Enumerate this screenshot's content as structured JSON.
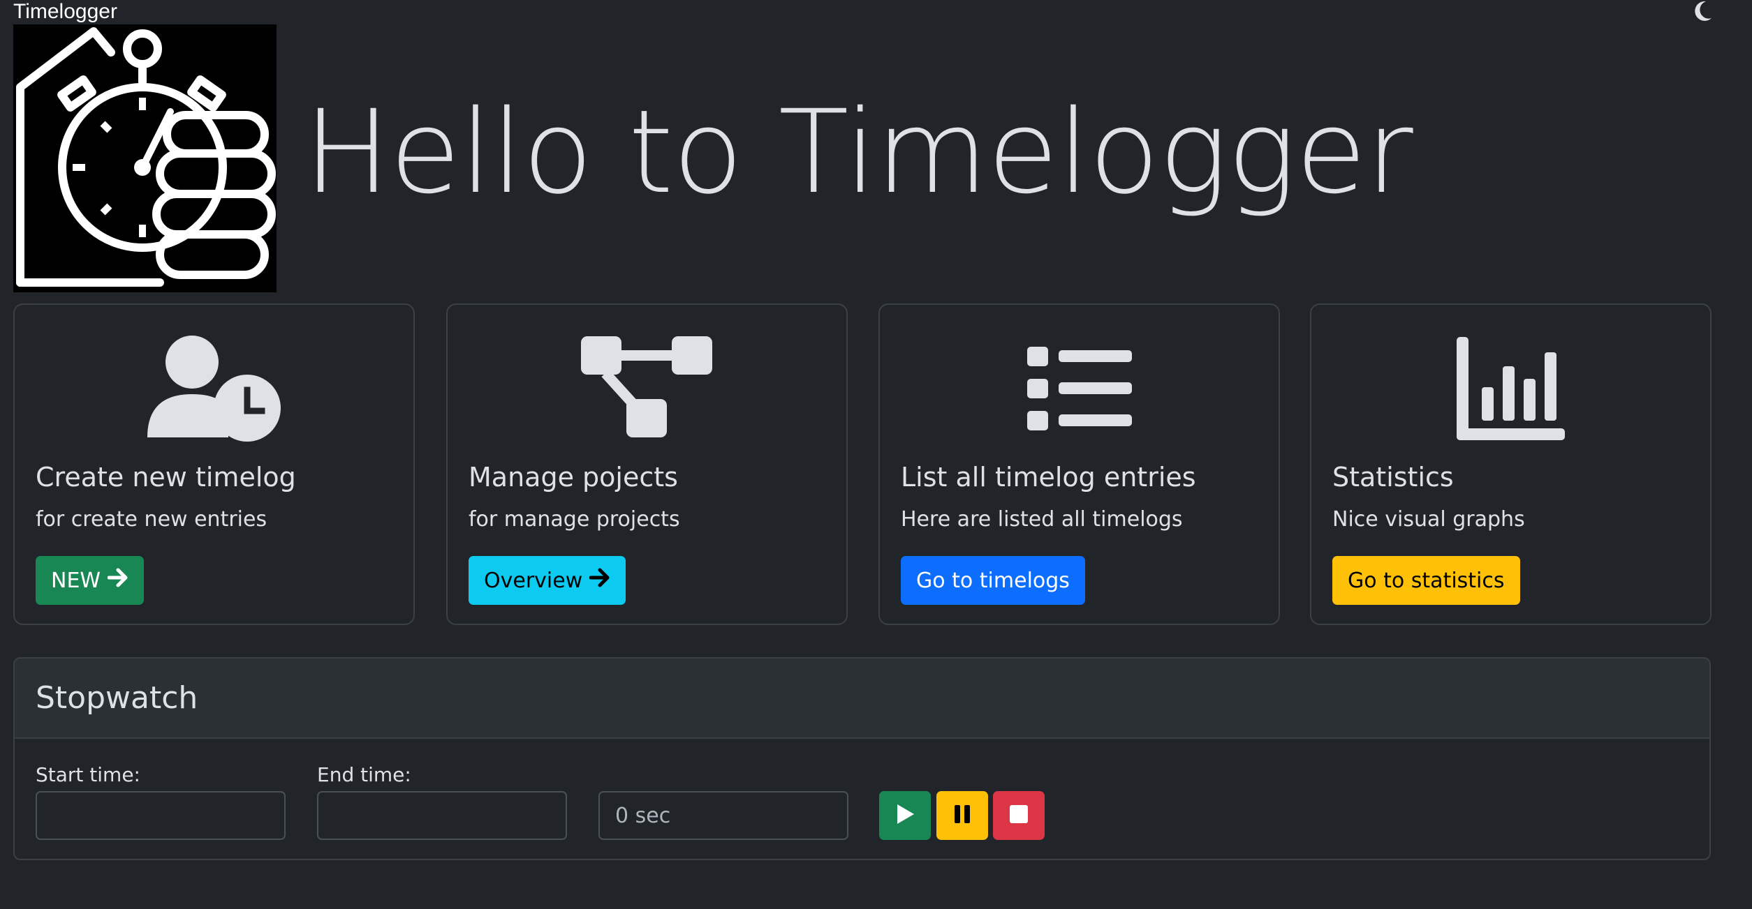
{
  "header": {
    "app_title": "Timelogger",
    "hero_title": "Hello to Timelogger"
  },
  "cards": [
    {
      "title": "Create new timelog",
      "subtitle": "for create new entries",
      "button": "NEW",
      "icon": "user-clock-icon",
      "color": "#198754"
    },
    {
      "title": "Manage pojects",
      "subtitle": "for manage projects",
      "button": "Overview",
      "icon": "project-diagram-icon",
      "color": "#0dcaf0"
    },
    {
      "title": "List all timelog entries",
      "subtitle": "Here are listed all timelogs",
      "button": "Go to timelogs",
      "icon": "list-icon",
      "color": "#0d6efd"
    },
    {
      "title": "Statistics",
      "subtitle": "Nice visual graphs",
      "button": "Go to statistics",
      "icon": "chart-bar-icon",
      "color": "#ffc107"
    }
  ],
  "stopwatch": {
    "title": "Stopwatch",
    "start_label": "Start time:",
    "end_label": "End time:",
    "start_value": "",
    "end_value": "",
    "elapsed": "0 sec",
    "buttons": [
      {
        "icon": "play-icon",
        "color": "#198754"
      },
      {
        "icon": "pause-icon",
        "color": "#ffc107"
      },
      {
        "icon": "stop-icon",
        "color": "#dc3545"
      }
    ]
  }
}
